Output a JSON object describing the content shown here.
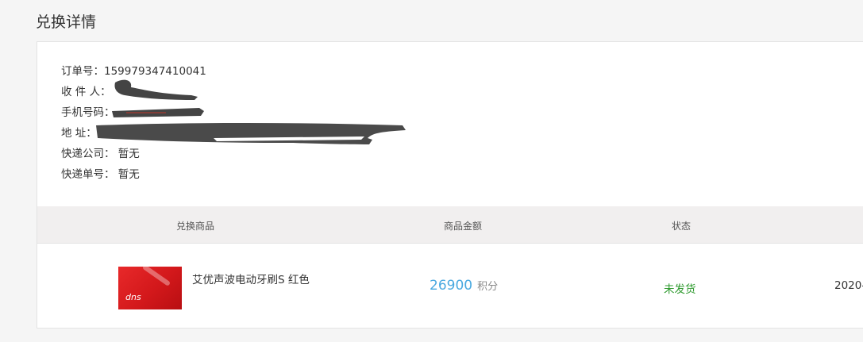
{
  "page": {
    "title": "兑换详情"
  },
  "order": {
    "order_no_label": "订单号：",
    "order_no": "159979347410041",
    "receiver_label": "收 件 人：",
    "phone_label": "手机号码：",
    "address_label": "地 址：",
    "courier_label": "快递公司：",
    "courier_value": "暂无",
    "tracking_label": "快递单号：",
    "tracking_value": "暂无"
  },
  "table": {
    "headers": [
      "兑换商品",
      "商品金额",
      "状态"
    ],
    "rows": [
      {
        "product": "艾优声波电动牙刷S 红色",
        "thumb_text": "dns",
        "amount": "26900",
        "unit": "积分",
        "status": "未发货",
        "date": "2020-"
      }
    ]
  },
  "colors": {
    "amount": "#4aa9e0",
    "status": "#2e9a2e",
    "header_bg": "#f1efef",
    "thumb": "#e8292a"
  }
}
